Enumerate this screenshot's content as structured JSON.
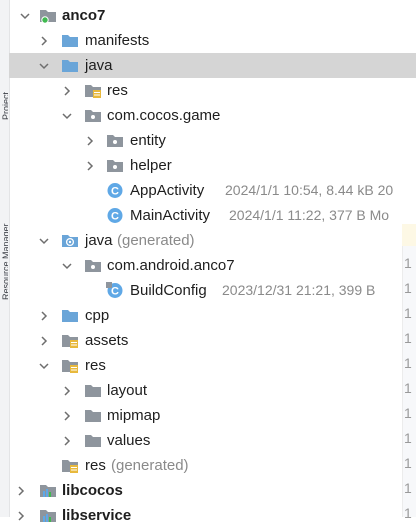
{
  "side_panel": {
    "label_top": "Project",
    "label_bottom": "Resource Manager"
  },
  "tree": {
    "root": {
      "label": "anco7"
    },
    "manifests": {
      "label": "manifests"
    },
    "java": {
      "label": "java"
    },
    "res_in_java": {
      "label": "res"
    },
    "pkg_game": {
      "label": "com.cocos.game"
    },
    "entity": {
      "label": "entity"
    },
    "helper": {
      "label": "helper"
    },
    "app_activity": {
      "label": "AppActivity",
      "meta": "2024/1/1 10:54, 8.44 kB 20"
    },
    "main_activity": {
      "label": "MainActivity",
      "meta": "2024/1/1 11:22, 377 B Mo"
    },
    "java_generated": {
      "label": "java",
      "suffix": "(generated)"
    },
    "pkg_android": {
      "label": "com.android.anco7"
    },
    "build_config": {
      "label": "BuildConfig",
      "meta": "2023/12/31 21:21, 399 B"
    },
    "cpp": {
      "label": "cpp"
    },
    "assets": {
      "label": "assets"
    },
    "res": {
      "label": "res"
    },
    "layout": {
      "label": "layout"
    },
    "mipmap": {
      "label": "mipmap"
    },
    "values": {
      "label": "values"
    },
    "res_generated": {
      "label": "res",
      "suffix": "(generated)"
    },
    "libcocos": {
      "label": "libcocos"
    },
    "libservice": {
      "label": "libservice"
    }
  },
  "gutter": {
    "line_digit": "1"
  },
  "colors": {
    "folder_blue": "#6aa5d8",
    "folder_grey": "#8e959d",
    "class_badge": "#5fa8e6",
    "selection": "#d5d5d5",
    "meta_text": "#8a8a8a"
  }
}
